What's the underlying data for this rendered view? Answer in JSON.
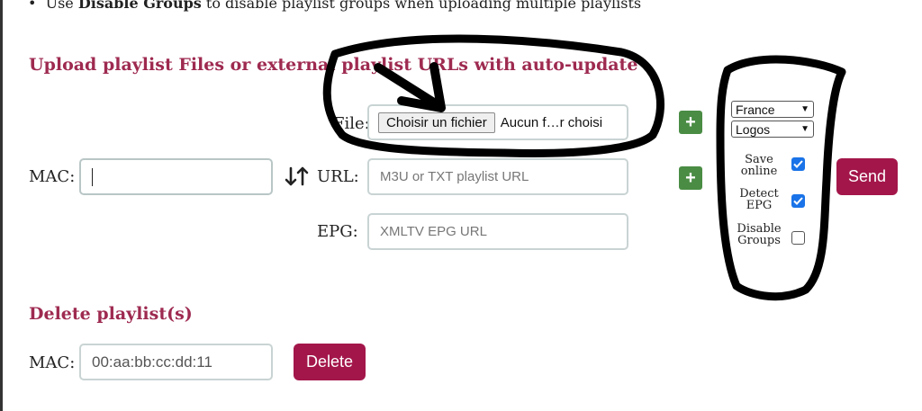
{
  "intro": {
    "prefix": "Use ",
    "bold": "Disable Groups",
    "suffix": " to disable playlist groups when uploading multiple playlists"
  },
  "upload": {
    "heading": "Upload playlist Files or external playlist URLs with auto-update",
    "file_label": "File:",
    "file_button": "Choisir un fichier",
    "file_status": "Aucun f…r choisi",
    "mac_label": "MAC:",
    "mac_value": "",
    "url_label": "URL:",
    "url_placeholder": "M3U or TXT playlist URL",
    "epg_label": "EPG:",
    "epg_placeholder": "XMLTV EPG URL",
    "add_symbol": "+",
    "country_select": "France",
    "logos_select": "Logos",
    "save_online_label": "Save online",
    "save_online_checked": true,
    "detect_epg_label": "Detect EPG",
    "detect_epg_checked": true,
    "disable_groups_label": "Disable Groups",
    "disable_groups_checked": false,
    "send_button": "Send"
  },
  "delete": {
    "heading": "Delete playlist(s)",
    "mac_label": "MAC:",
    "mac_placeholder": "00:aa:bb:cc:dd:11",
    "delete_button": "Delete"
  },
  "colors": {
    "heading": "#9e2a50",
    "button": "#a3164a",
    "add": "#4a8c44",
    "checkbox": "#1a73e8"
  },
  "icons": [
    "swap-vertical-icon",
    "chevron-down-icon",
    "check-icon",
    "bullet-icon"
  ]
}
